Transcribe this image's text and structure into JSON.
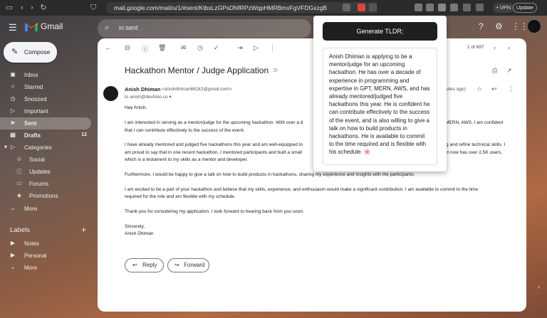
{
  "browser": {
    "url": "mail.google.com/mail/u/1/#sent/KtbxLzGPsDNfRPzWqpHMRBmxFgVFDGxzgB",
    "vpn_label": "• VPN",
    "update_label": "Update"
  },
  "gmail": {
    "brand": "Gmail",
    "search_value": "in:sent",
    "compose_label": "Compose"
  },
  "sidebar": {
    "items": [
      {
        "label": "Inbox",
        "icon": "inbox-icon",
        "count": ""
      },
      {
        "label": "Starred",
        "icon": "star-icon",
        "count": ""
      },
      {
        "label": "Snoozed",
        "icon": "clock-icon",
        "count": ""
      },
      {
        "label": "Important",
        "icon": "important-icon",
        "count": ""
      },
      {
        "label": "Sent",
        "icon": "send-icon",
        "count": ""
      },
      {
        "label": "Drafts",
        "icon": "draft-icon",
        "count": "12"
      },
      {
        "label": "Categories",
        "icon": "label-icon",
        "count": ""
      },
      {
        "label": "Social",
        "icon": "people-icon",
        "count": ""
      },
      {
        "label": "Updates",
        "icon": "info-icon",
        "count": ""
      },
      {
        "label": "Forums",
        "icon": "forum-icon",
        "count": ""
      },
      {
        "label": "Promotions",
        "icon": "tag-icon",
        "count": ""
      },
      {
        "label": "More",
        "icon": "chevron-down-icon",
        "count": ""
      }
    ],
    "labels_header": "Labels",
    "labels": [
      {
        "label": "Notes",
        "icon": "label-icon"
      },
      {
        "label": "Personal",
        "icon": "label-icon"
      },
      {
        "label": "More",
        "icon": "chevron-down-icon"
      }
    ]
  },
  "email": {
    "pager": "1 of 697",
    "subject": "Hackathon Mentor / Judge Application",
    "sender_name": "Anish Dhiman",
    "sender_email": "<anishdhiman662k2@gmail.com>",
    "to_line": "to anish@devfolio.co ▾",
    "time_ago": "nutes ago)",
    "greeting": "Hey Anish,",
    "para1": "I am interested in serving as a mentor/judge for the upcoming hackathon. With over a d",
    "para1_tail": "MERN, AWS, I am confident",
    "para1b": "that I can contribute effectively to the success of the event.",
    "para2a": "I have already mentored and judged five hackathons this year and am well-equipped to",
    "para2a_tail": "ing and refine technical skills. I",
    "para2b": "am proud to say that in one recent hackathon, I mentored participants and built a small",
    "para2b_tail": "ct now has over 2.5K users,",
    "para2c": "which is a testament to my skills as a mentor and developer.",
    "para3": "Furthermore, I would be happy to give a talk on how to build products in hackathons, sharing my experience and insights with the participants.",
    "para4a": "I am excited to be a part of your hackathon and believe that my skills, experience, and enthusiasm would make a significant contribution. I am available to commit to the time",
    "para4b": "required for the role and am flexible with my schedule.",
    "para5": "Thank you for considering my application. I look forward to hearing back from you soon.",
    "sign1": "Sincerely,",
    "sign2": "Anish Dhiman",
    "reply_label": "Reply",
    "forward_label": "Forward"
  },
  "popup": {
    "button_label": "Generate TLDR;",
    "summary": "Anish Dhiman is applying to be a mentor/judge for an upcoming hackathon. He has over a decade of experience in programming and expertise in GPT, MERN, AWS, and has already mentored/judged five hackathons this year. He is confident he can contribute effectively to the success of the event, and is also willing to give a talk on how to build products in hackathons. He is available to commit to the time required and is flexible with his schedule. 🌸"
  },
  "colors": {
    "gmail_red": "#ea4335",
    "popup_button": "#1f1f1f",
    "sidebar_active": "rgba(255,255,255,0.25)"
  }
}
